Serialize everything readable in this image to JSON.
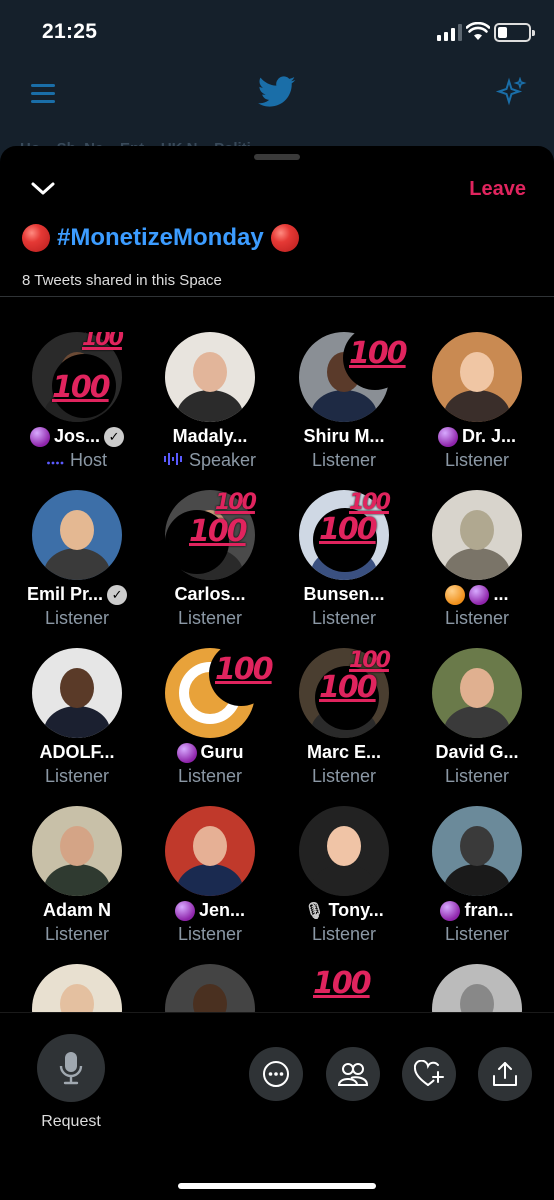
{
  "status": {
    "time": "21:25"
  },
  "header": {
    "topics": "Ho...  Sh. Ne...  Ent...   UK N...   Politi..."
  },
  "space": {
    "leave_label": "Leave",
    "title": "#MonetizeMonday",
    "tweets_shared": "8 Tweets shared in this Space",
    "reaction_text": "100"
  },
  "participants": [
    {
      "name": "Jos...",
      "role": "Host",
      "prefix_dot": "purple",
      "verified": true
    },
    {
      "name": "Madaly...",
      "role": "Speaker"
    },
    {
      "name": "Shiru M...",
      "role": "Listener"
    },
    {
      "name": "Dr. J...",
      "role": "Listener",
      "prefix_dot": "purple"
    },
    {
      "name": "Emil Pr...",
      "role": "Listener",
      "verified": true
    },
    {
      "name": "Carlos...",
      "role": "Listener"
    },
    {
      "name": "Bunsen...",
      "role": "Listener"
    },
    {
      "name": "...",
      "role": "Listener",
      "prefix_dot": "orange",
      "extra_dot": "purple"
    },
    {
      "name": "ADOLF...",
      "role": "Listener"
    },
    {
      "name": "Guru",
      "role": "Listener",
      "prefix_dot": "purple"
    },
    {
      "name": "Marc E...",
      "role": "Listener"
    },
    {
      "name": "David G...",
      "role": "Listener"
    },
    {
      "name": "Adam N",
      "role": "Listener"
    },
    {
      "name": "Jen...",
      "role": "Listener",
      "prefix_dot": "purple"
    },
    {
      "name": "Tony...",
      "role": "Listener",
      "prefix_icon": "microphone"
    },
    {
      "name": "fran...",
      "role": "Listener",
      "prefix_dot": "purple"
    }
  ],
  "bottom": {
    "request_label": "Request"
  },
  "colors": {
    "accent": "#3c9cff",
    "leave": "#e0245e",
    "muted": "#8b98a5",
    "host_indicator": "#5b5bff"
  }
}
